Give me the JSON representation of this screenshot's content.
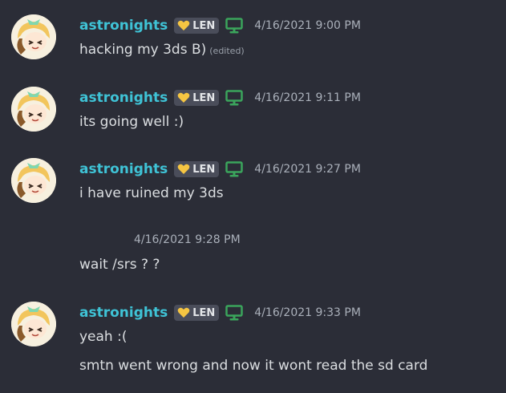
{
  "messages": [
    {
      "username": "astronights",
      "tag": "LEN",
      "timestamp": "4/16/2021 9:00 PM",
      "lines": [
        "hacking my 3ds B)"
      ],
      "edited": "(edited)"
    },
    {
      "username": "astronights",
      "tag": "LEN",
      "timestamp": "4/16/2021 9:11 PM",
      "lines": [
        "its going well :)"
      ]
    },
    {
      "username": "astronights",
      "tag": "LEN",
      "timestamp": "4/16/2021 9:27 PM",
      "lines": [
        "i have ruined my 3ds"
      ]
    },
    {
      "timestamp": "4/16/2021 9:28 PM",
      "lines": [
        "wait /srs ? ?"
      ]
    },
    {
      "username": "astronights",
      "tag": "LEN",
      "timestamp": "4/16/2021 9:33 PM",
      "lines": [
        "yeah :(",
        "smtn went wrong and now it wont read the sd card"
      ]
    }
  ],
  "icons": {
    "tag_icon": "heart-icon",
    "device_icon": "desktop-icon"
  },
  "colors": {
    "background": "#2b2d37",
    "username": "#3fc3d6",
    "tag_bg": "#4a4d5a",
    "heart": "#f5c542",
    "device": "#3ba55c"
  }
}
